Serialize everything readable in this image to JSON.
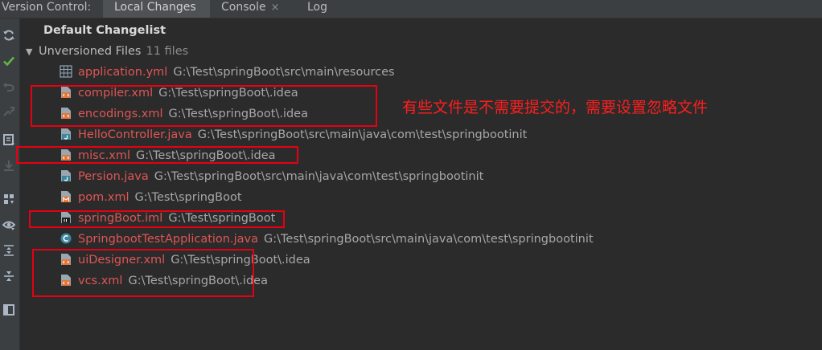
{
  "topbar": {
    "title": "Version Control:",
    "tabs": [
      {
        "label": "Local Changes",
        "active": true
      },
      {
        "label": "Console",
        "closable": true,
        "close_glyph": "×"
      },
      {
        "label": "Log"
      }
    ]
  },
  "toolbar": {
    "icons": [
      "refresh-icon",
      "commit-check-icon",
      "rollback-icon",
      "diff-icon",
      "shelve-icon",
      "update-icon",
      "group-by-icon",
      "show-ignored-icon",
      "expand-all-icon",
      "collapse-all-icon",
      "preview-pane-icon"
    ]
  },
  "tree": {
    "changelist": "Default Changelist",
    "group": {
      "arrow": "▼",
      "label": "Unversioned Files",
      "count": "11 files"
    },
    "files": [
      {
        "name": "application.yml",
        "path": "G:\\Test\\springBoot\\src\\main\\resources",
        "icon": "yml-file-icon"
      },
      {
        "name": "compiler.xml",
        "path": "G:\\Test\\springBoot\\.idea",
        "icon": "xml-file-icon"
      },
      {
        "name": "encodings.xml",
        "path": "G:\\Test\\springBoot\\.idea",
        "icon": "xml-file-icon"
      },
      {
        "name": "HelloController.java",
        "path": "G:\\Test\\springBoot\\src\\main\\java\\com\\test\\springbootinit",
        "icon": "java-file-icon"
      },
      {
        "name": "misc.xml",
        "path": "G:\\Test\\springBoot\\.idea",
        "icon": "xml-file-icon"
      },
      {
        "name": "Persion.java",
        "path": "G:\\Test\\springBoot\\src\\main\\java\\com\\test\\springbootinit",
        "icon": "java-file-icon"
      },
      {
        "name": "pom.xml",
        "path": "G:\\Test\\springBoot",
        "icon": "maven-file-icon"
      },
      {
        "name": "springBoot.iml",
        "path": "G:\\Test\\springBoot",
        "icon": "iml-file-icon"
      },
      {
        "name": "SpringbootTestApplication.java",
        "path": "G:\\Test\\springBoot\\src\\main\\java\\com\\test\\springbootinit",
        "icon": "spring-class-icon"
      },
      {
        "name": "uiDesigner.xml",
        "path": "G:\\Test\\springBoot\\.idea",
        "icon": "xml-file-icon"
      },
      {
        "name": "vcs.xml",
        "path": "G:\\Test\\springBoot\\.idea",
        "icon": "xml-file-icon"
      }
    ]
  },
  "annotation": {
    "text": "有些文件是不需要提交的，需要设置忽略文件",
    "color": "#ff1e1e"
  },
  "colors": {
    "background": "#2b2b2b",
    "panel": "#3c3f41",
    "unversioned_file": "#e05555",
    "path": "#a7a7a7",
    "highlight_box": "#e60012"
  }
}
